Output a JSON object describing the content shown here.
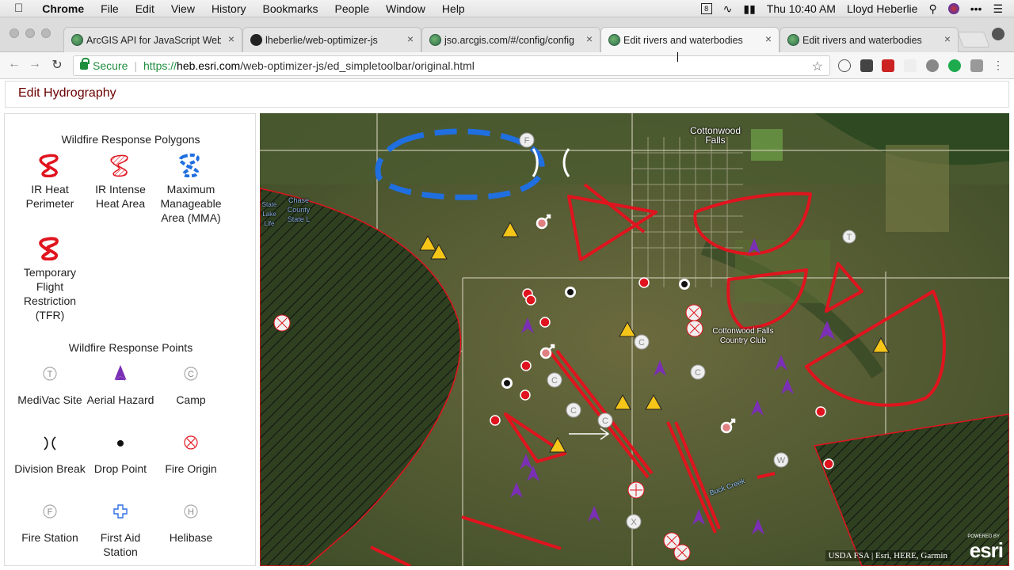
{
  "menubar": {
    "apple": "",
    "app": "Chrome",
    "items": [
      "File",
      "Edit",
      "View",
      "History",
      "Bookmarks",
      "People",
      "Window",
      "Help"
    ],
    "clock": "Thu 10:40 AM",
    "user": "Lloyd Heberlie"
  },
  "tabs": [
    {
      "title": "ArcGIS API for JavaScript Web",
      "icon": "globe-icon"
    },
    {
      "title": "lheberlie/web-optimizer-js",
      "icon": "github-icon"
    },
    {
      "title": "jso.arcgis.com/#/config/config",
      "icon": "globe-icon"
    },
    {
      "title": "Edit rivers and waterbodies",
      "icon": "globe-icon",
      "active": true
    },
    {
      "title": "Edit rivers and waterbodies",
      "icon": "globe-icon"
    }
  ],
  "address": {
    "secure_label": "Secure",
    "scheme": "https://",
    "host": "heb.esri.com",
    "path": "/web-optimizer-js/ed_simpletoolbar/original.html"
  },
  "page": {
    "title": "Edit Hydrography"
  },
  "legend": {
    "polygons_heading": "Wildfire Response Polygons",
    "polygons": [
      {
        "label": "IR Heat Perimeter",
        "icon": "ir-heat-perimeter-icon",
        "color": "#e0141e"
      },
      {
        "label": "IR Intense Heat Area",
        "icon": "ir-intense-heat-icon",
        "color": "#e0141e"
      },
      {
        "label": "Maximum Manageable Area (MMA)",
        "icon": "mma-icon",
        "color": "#1f6fe0"
      },
      {
        "label": "Temporary Flight Restriction (TFR)",
        "icon": "tfr-icon",
        "color": "#e0141e"
      }
    ],
    "points_heading": "Wildfire Response Points",
    "points": [
      {
        "label": "MediVac Site",
        "icon": "medivac-icon"
      },
      {
        "label": "Aerial Hazard",
        "icon": "aerial-hazard-icon",
        "color": "#7a2fb5"
      },
      {
        "label": "Camp",
        "icon": "camp-icon"
      },
      {
        "label": "Division Break",
        "icon": "division-break-icon"
      },
      {
        "label": "Drop Point",
        "icon": "drop-point-icon"
      },
      {
        "label": "Fire Origin",
        "icon": "fire-origin-icon",
        "color": "#e0141e"
      },
      {
        "label": "Fire Station",
        "icon": "fire-station-icon"
      },
      {
        "label": "First Aid Station",
        "icon": "first-aid-icon",
        "color": "#2f6fe0"
      },
      {
        "label": "Helibase",
        "icon": "helibase-icon"
      }
    ]
  },
  "map": {
    "labels": {
      "town": "Cottonwood Falls",
      "club": "Cottonwood Falls Country Club",
      "lake": "Chase County State L",
      "park": "State Lake Life",
      "creek": "Buck Creek"
    },
    "attribution": "USDA FSA | Esri, HERE, Garmin",
    "logo_powered": "POWERED BY",
    "logo": "esri"
  }
}
